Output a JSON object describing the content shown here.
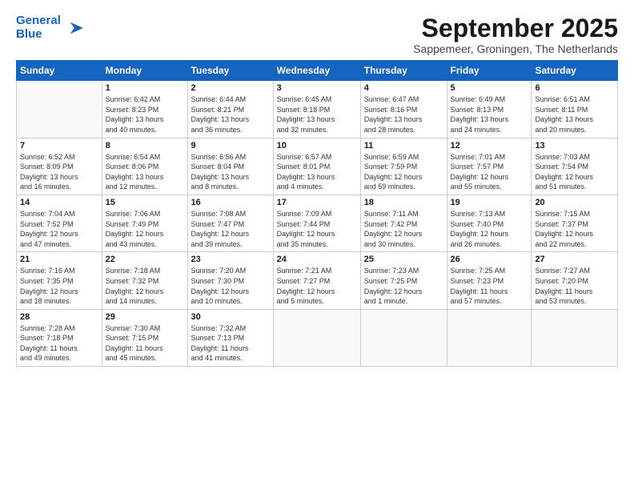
{
  "logo": {
    "line1": "General",
    "line2": "Blue"
  },
  "title": "September 2025",
  "subtitle": "Sappemeer, Groningen, The Netherlands",
  "days_of_week": [
    "Sunday",
    "Monday",
    "Tuesday",
    "Wednesday",
    "Thursday",
    "Friday",
    "Saturday"
  ],
  "weeks": [
    [
      {
        "day": "",
        "info": ""
      },
      {
        "day": "1",
        "info": "Sunrise: 6:42 AM\nSunset: 8:23 PM\nDaylight: 13 hours\nand 40 minutes."
      },
      {
        "day": "2",
        "info": "Sunrise: 6:44 AM\nSunset: 8:21 PM\nDaylight: 13 hours\nand 36 minutes."
      },
      {
        "day": "3",
        "info": "Sunrise: 6:45 AM\nSunset: 8:18 PM\nDaylight: 13 hours\nand 32 minutes."
      },
      {
        "day": "4",
        "info": "Sunrise: 6:47 AM\nSunset: 8:16 PM\nDaylight: 13 hours\nand 28 minutes."
      },
      {
        "day": "5",
        "info": "Sunrise: 6:49 AM\nSunset: 8:13 PM\nDaylight: 13 hours\nand 24 minutes."
      },
      {
        "day": "6",
        "info": "Sunrise: 6:51 AM\nSunset: 8:11 PM\nDaylight: 13 hours\nand 20 minutes."
      }
    ],
    [
      {
        "day": "7",
        "info": "Sunrise: 6:52 AM\nSunset: 8:09 PM\nDaylight: 13 hours\nand 16 minutes."
      },
      {
        "day": "8",
        "info": "Sunrise: 6:54 AM\nSunset: 8:06 PM\nDaylight: 13 hours\nand 12 minutes."
      },
      {
        "day": "9",
        "info": "Sunrise: 6:56 AM\nSunset: 8:04 PM\nDaylight: 13 hours\nand 8 minutes."
      },
      {
        "day": "10",
        "info": "Sunrise: 6:57 AM\nSunset: 8:01 PM\nDaylight: 13 hours\nand 4 minutes."
      },
      {
        "day": "11",
        "info": "Sunrise: 6:59 AM\nSunset: 7:59 PM\nDaylight: 12 hours\nand 59 minutes."
      },
      {
        "day": "12",
        "info": "Sunrise: 7:01 AM\nSunset: 7:57 PM\nDaylight: 12 hours\nand 55 minutes."
      },
      {
        "day": "13",
        "info": "Sunrise: 7:03 AM\nSunset: 7:54 PM\nDaylight: 12 hours\nand 51 minutes."
      }
    ],
    [
      {
        "day": "14",
        "info": "Sunrise: 7:04 AM\nSunset: 7:52 PM\nDaylight: 12 hours\nand 47 minutes."
      },
      {
        "day": "15",
        "info": "Sunrise: 7:06 AM\nSunset: 7:49 PM\nDaylight: 12 hours\nand 43 minutes."
      },
      {
        "day": "16",
        "info": "Sunrise: 7:08 AM\nSunset: 7:47 PM\nDaylight: 12 hours\nand 39 minutes."
      },
      {
        "day": "17",
        "info": "Sunrise: 7:09 AM\nSunset: 7:44 PM\nDaylight: 12 hours\nand 35 minutes."
      },
      {
        "day": "18",
        "info": "Sunrise: 7:11 AM\nSunset: 7:42 PM\nDaylight: 12 hours\nand 30 minutes."
      },
      {
        "day": "19",
        "info": "Sunrise: 7:13 AM\nSunset: 7:40 PM\nDaylight: 12 hours\nand 26 minutes."
      },
      {
        "day": "20",
        "info": "Sunrise: 7:15 AM\nSunset: 7:37 PM\nDaylight: 12 hours\nand 22 minutes."
      }
    ],
    [
      {
        "day": "21",
        "info": "Sunrise: 7:16 AM\nSunset: 7:35 PM\nDaylight: 12 hours\nand 18 minutes."
      },
      {
        "day": "22",
        "info": "Sunrise: 7:18 AM\nSunset: 7:32 PM\nDaylight: 12 hours\nand 14 minutes."
      },
      {
        "day": "23",
        "info": "Sunrise: 7:20 AM\nSunset: 7:30 PM\nDaylight: 12 hours\nand 10 minutes."
      },
      {
        "day": "24",
        "info": "Sunrise: 7:21 AM\nSunset: 7:27 PM\nDaylight: 12 hours\nand 5 minutes."
      },
      {
        "day": "25",
        "info": "Sunrise: 7:23 AM\nSunset: 7:25 PM\nDaylight: 12 hours\nand 1 minute."
      },
      {
        "day": "26",
        "info": "Sunrise: 7:25 AM\nSunset: 7:23 PM\nDaylight: 11 hours\nand 57 minutes."
      },
      {
        "day": "27",
        "info": "Sunrise: 7:27 AM\nSunset: 7:20 PM\nDaylight: 11 hours\nand 53 minutes."
      }
    ],
    [
      {
        "day": "28",
        "info": "Sunrise: 7:28 AM\nSunset: 7:18 PM\nDaylight: 11 hours\nand 49 minutes."
      },
      {
        "day": "29",
        "info": "Sunrise: 7:30 AM\nSunset: 7:15 PM\nDaylight: 11 hours\nand 45 minutes."
      },
      {
        "day": "30",
        "info": "Sunrise: 7:32 AM\nSunset: 7:13 PM\nDaylight: 11 hours\nand 41 minutes."
      },
      {
        "day": "",
        "info": ""
      },
      {
        "day": "",
        "info": ""
      },
      {
        "day": "",
        "info": ""
      },
      {
        "day": "",
        "info": ""
      }
    ]
  ]
}
